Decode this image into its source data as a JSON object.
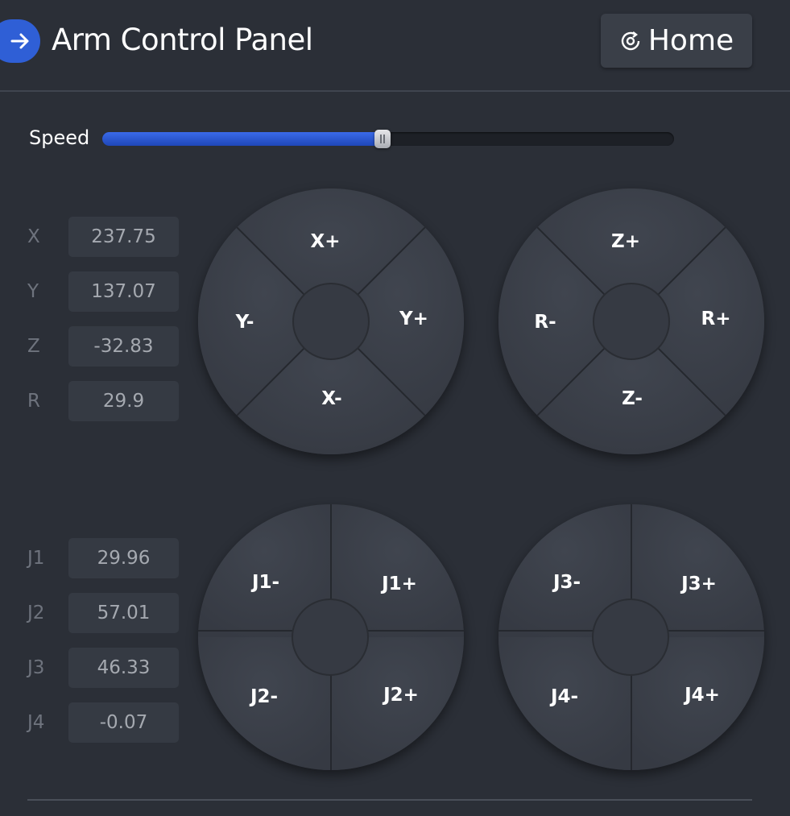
{
  "header": {
    "title": "Arm Control Panel",
    "home_label": "Home",
    "back_icon": "arrow-right-icon",
    "home_icon": "home-reset-icon"
  },
  "speed": {
    "label": "Speed",
    "value_fraction": 0.49
  },
  "coordinates": [
    {
      "label": "X",
      "value": "237.75"
    },
    {
      "label": "Y",
      "value": "137.07"
    },
    {
      "label": "Z",
      "value": "-32.83"
    },
    {
      "label": "R",
      "value": "29.9"
    }
  ],
  "joints": [
    {
      "label": "J1",
      "value": "29.96"
    },
    {
      "label": "J2",
      "value": "57.01"
    },
    {
      "label": "J3",
      "value": "46.33"
    },
    {
      "label": "J4",
      "value": "-0.07"
    }
  ],
  "pads": {
    "xy": {
      "top": "X+",
      "bottom": "X-",
      "left": "Y-",
      "right": "Y+"
    },
    "zr": {
      "top": "Z+",
      "bottom": "Z-",
      "left": "R-",
      "right": "R+"
    },
    "j12": {
      "tl": "J1-",
      "tr": "J1+",
      "bl": "J2-",
      "br": "J2+"
    },
    "j34": {
      "tl": "J3-",
      "tr": "J3+",
      "bl": "J4-",
      "br": "J4+"
    }
  },
  "colors": {
    "accent": "#2f5fd6",
    "background": "#2b2f37",
    "pad": "#3a3f48"
  }
}
